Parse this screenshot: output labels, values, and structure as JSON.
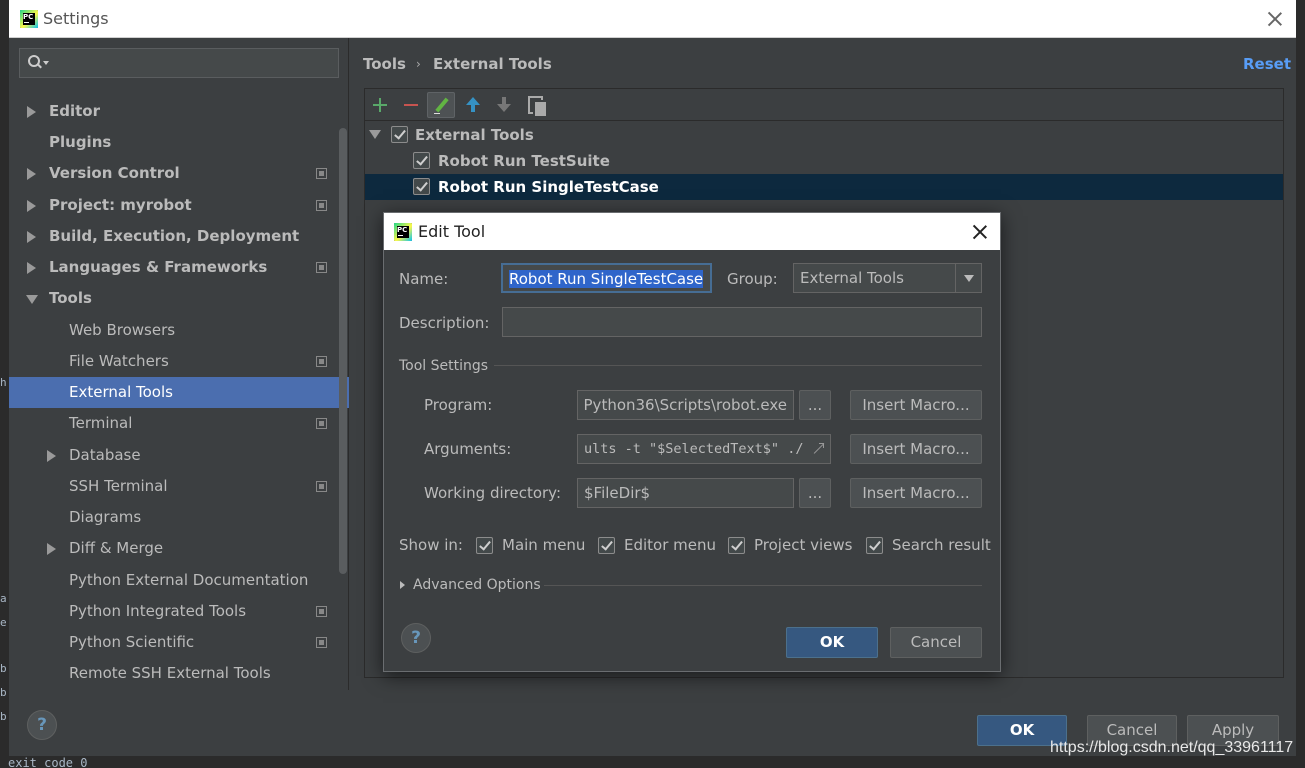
{
  "window": {
    "title": "Settings"
  },
  "search": {
    "placeholder": ""
  },
  "sidebar": {
    "items": [
      {
        "label": "Editor"
      },
      {
        "label": "Plugins"
      },
      {
        "label": "Version Control"
      },
      {
        "label": "Project: myrobot"
      },
      {
        "label": "Build, Execution, Deployment"
      },
      {
        "label": "Languages & Frameworks"
      },
      {
        "label": "Tools"
      },
      {
        "label": "Web Browsers"
      },
      {
        "label": "File Watchers"
      },
      {
        "label": "External Tools"
      },
      {
        "label": "Terminal"
      },
      {
        "label": "Database"
      },
      {
        "label": "SSH Terminal"
      },
      {
        "label": "Diagrams"
      },
      {
        "label": "Diff & Merge"
      },
      {
        "label": "Python External Documentation"
      },
      {
        "label": "Python Integrated Tools"
      },
      {
        "label": "Python Scientific"
      },
      {
        "label": "Remote SSH External Tools"
      }
    ]
  },
  "breadcrumb": {
    "parent": "Tools",
    "separator": "›",
    "current": "External Tools"
  },
  "header": {
    "reset_label": "Reset"
  },
  "tools_list": {
    "group": "External Tools",
    "items": [
      "Robot Run TestSuite",
      "Robot Run SingleTestCase"
    ]
  },
  "edit_tool": {
    "title": "Edit Tool",
    "name_label": "Name:",
    "name_value": "Robot Run SingleTestCase",
    "group_label": "Group:",
    "group_value": "External Tools",
    "description_label": "Description:",
    "description_value": "",
    "tool_settings_title": "Tool Settings",
    "program_label": "Program:",
    "program_value": "Python36\\Scripts\\robot.exe",
    "arguments_label": "Arguments:",
    "arguments_value": "ults -t \"$SelectedText$\" ./",
    "working_dir_label": "Working directory:",
    "working_dir_value": "$FileDir$",
    "browse_label": "...",
    "insert_macro_label": "Insert Macro...",
    "show_in_label": "Show in:",
    "show_in": [
      "Main menu",
      "Editor menu",
      "Project views",
      "Search result"
    ],
    "advanced_label": "Advanced Options",
    "help_label": "?",
    "ok_label": "OK",
    "cancel_label": "Cancel"
  },
  "footer": {
    "help_label": "?",
    "ok_label": "OK",
    "cancel_label": "Cancel",
    "apply_label": "Apply"
  },
  "background_editor": {
    "bottom_line": "exit code 0",
    "gutter_chars": [
      "h",
      "a",
      "e",
      "b",
      "b",
      "b"
    ]
  },
  "watermark": "https://blog.csdn.net/qq_33961117",
  "colors": {
    "selection": "#4b6eaf",
    "list_selection": "#0d293e",
    "link": "#589df6",
    "primary_button": "#365880"
  }
}
